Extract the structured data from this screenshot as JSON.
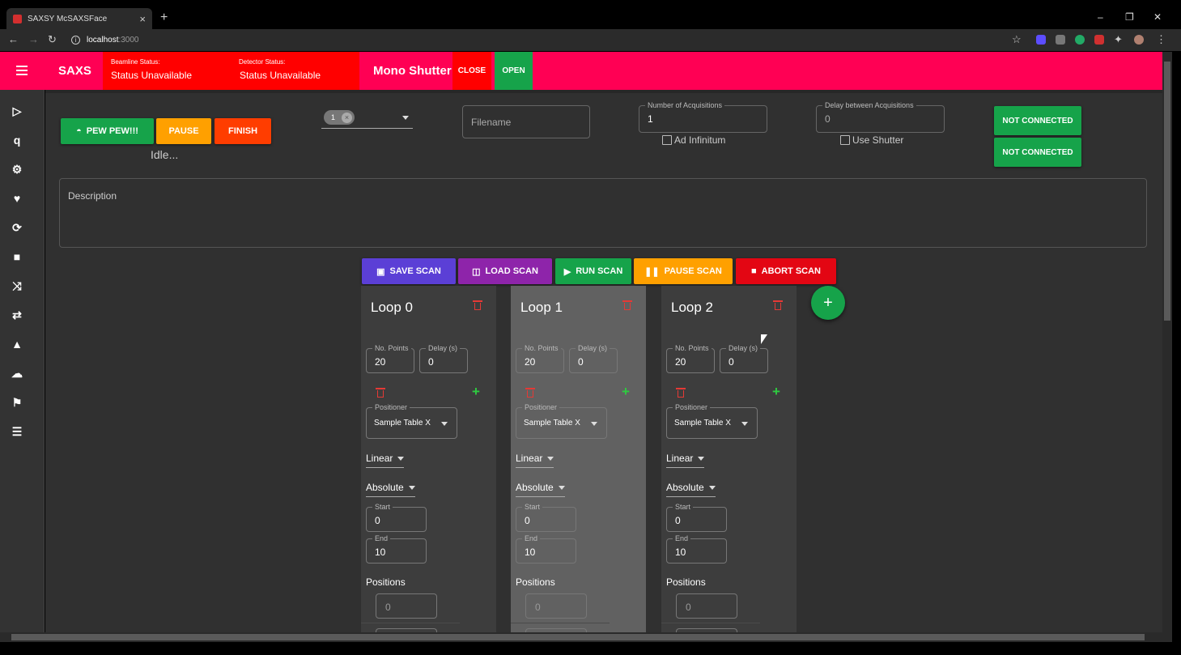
{
  "browser": {
    "tab_title": "SAXSY McSAXSFace",
    "url_host": "localhost",
    "url_port": ":3000"
  },
  "appbar": {
    "title": "SAXS",
    "beamline_label": "Beamline Status:",
    "beamline_value": "Status Unavailable",
    "detector_label": "Detector Status:",
    "detector_value": "Status Unavailable",
    "mono_label": "Mono Shutter:",
    "mono_close": "CLOSE",
    "mono_open": "OPEN"
  },
  "sidebar_icons": [
    "play-circle-icon",
    "q-icon",
    "gear-icon",
    "heart-icon",
    "sync-icon",
    "video-camera-icon",
    "shuffle-icon",
    "swap-arrows-icon",
    "warning-icon",
    "docker-icon",
    "flag-icon",
    "database-icon"
  ],
  "sidebar_q_text": "q",
  "controls": {
    "pew": "PEW PEW!!!",
    "pause": "PAUSE",
    "finish": "FINISH",
    "status": "Idle...",
    "chip_value": "1",
    "filename_placeholder": "Filename",
    "acq_label": "Number of Acquisitions",
    "acq_value": "1",
    "ad_infinitum": "Ad Infinitum",
    "delay_label": "Delay between Acquisitions",
    "delay_value": "0",
    "use_shutter": "Use Shutter",
    "not_connected_1": "NOT CONNECTED",
    "not_connected_2": "NOT CONNECTED"
  },
  "description_placeholder": "Description",
  "scan_buttons": {
    "save": "SAVE SCAN",
    "load": "LOAD SCAN",
    "run": "RUN SCAN",
    "pause": "PAUSE SCAN",
    "abort": "ABORT SCAN"
  },
  "loops": [
    {
      "title": "Loop 0",
      "points_label": "No. Points",
      "points": "20",
      "delay_label": "Delay (s)",
      "delay": "0",
      "positioner_label": "Positioner",
      "positioner": "Sample Table X",
      "mode": "Linear",
      "ref": "Absolute",
      "start_label": "Start",
      "start": "0",
      "end_label": "End",
      "end": "10",
      "positions_label": "Positions",
      "position_0": "0"
    },
    {
      "title": "Loop 1",
      "points_label": "No. Points",
      "points": "20",
      "delay_label": "Delay (s)",
      "delay": "0",
      "positioner_label": "Positioner",
      "positioner": "Sample Table X",
      "mode": "Linear",
      "ref": "Absolute",
      "start_label": "Start",
      "start": "0",
      "end_label": "End",
      "end": "10",
      "positions_label": "Positions",
      "position_0": "0"
    },
    {
      "title": "Loop 2",
      "points_label": "No. Points",
      "points": "20",
      "delay_label": "Delay (s)",
      "delay": "0",
      "positioner_label": "Positioner",
      "positioner": "Sample Table X",
      "mode": "Linear",
      "ref": "Absolute",
      "start_label": "Start",
      "start": "0",
      "end_label": "End",
      "end": "10",
      "positions_label": "Positions",
      "position_0": "0"
    }
  ],
  "add_loop": "+",
  "colors": {
    "appbar": "#ff0054",
    "status_red": "#ff0000",
    "green": "#16a34a",
    "orange": "#ffa000",
    "finish": "#ff3d00",
    "save": "#5b3fd6",
    "load": "#8e24aa",
    "abort": "#e30613"
  }
}
